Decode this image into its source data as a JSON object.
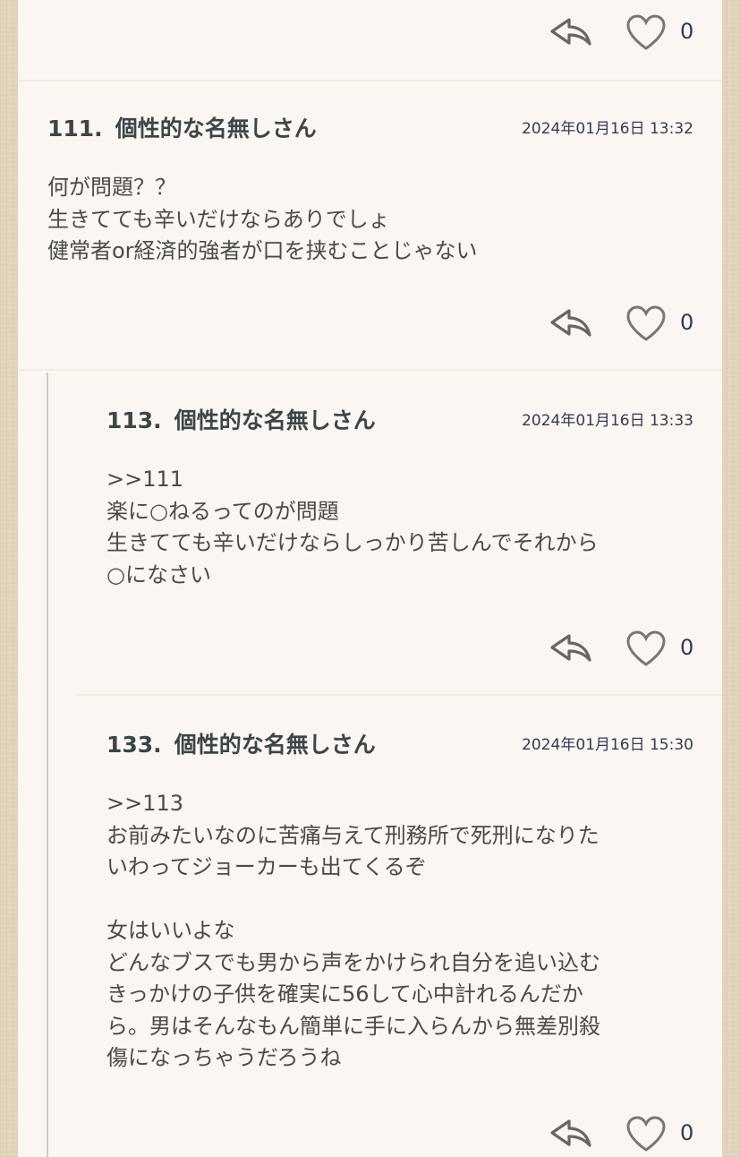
{
  "top_item": {
    "like_count": "0"
  },
  "comments": [
    {
      "number": "111.",
      "name": "個性的な名無しさん",
      "date": "2024年01月16日 13:32",
      "lines": [
        "何が問題？？",
        "生きてても辛いだけならありでしょ",
        "健常者or経済的強者が口を挟むことじゃない"
      ],
      "like_count": "0"
    },
    {
      "number": "113.",
      "name": "個性的な名無しさん",
      "date": "2024年01月16日 13:33",
      "lines": [
        ">>111",
        "楽に○ねるってのが問題",
        "生きてても辛いだけならしっかり苦しんでそれから",
        "○になさい"
      ],
      "like_count": "0"
    },
    {
      "number": "133.",
      "name": "個性的な名無しさん",
      "date": "2024年01月16日 15:30",
      "lines": [
        ">>113",
        "お前みたいなのに苦痛与えて刑務所で死刑になりた",
        "いわってジョーカーも出てくるぞ",
        "",
        "女はいいよな",
        "どんなブスでも男から声をかけられ自分を追い込む",
        "きっかけの子供を確実に56して心中計れるんだか",
        "ら。男はそんなもん簡単に手に入らんから無差別殺",
        "傷になっちゃうだろうね"
      ],
      "like_count": "0"
    }
  ],
  "icons": {
    "reply": "reply-arrow-icon",
    "like": "heart-outline-icon"
  },
  "colors": {
    "background": "#e3d6be",
    "card": "#fbf6f1",
    "name_text": "#3c4548",
    "date_text": "#343a52",
    "body_text": "#4a4a4a",
    "icon": "#666666",
    "thread_line": "#c9ccc4"
  }
}
